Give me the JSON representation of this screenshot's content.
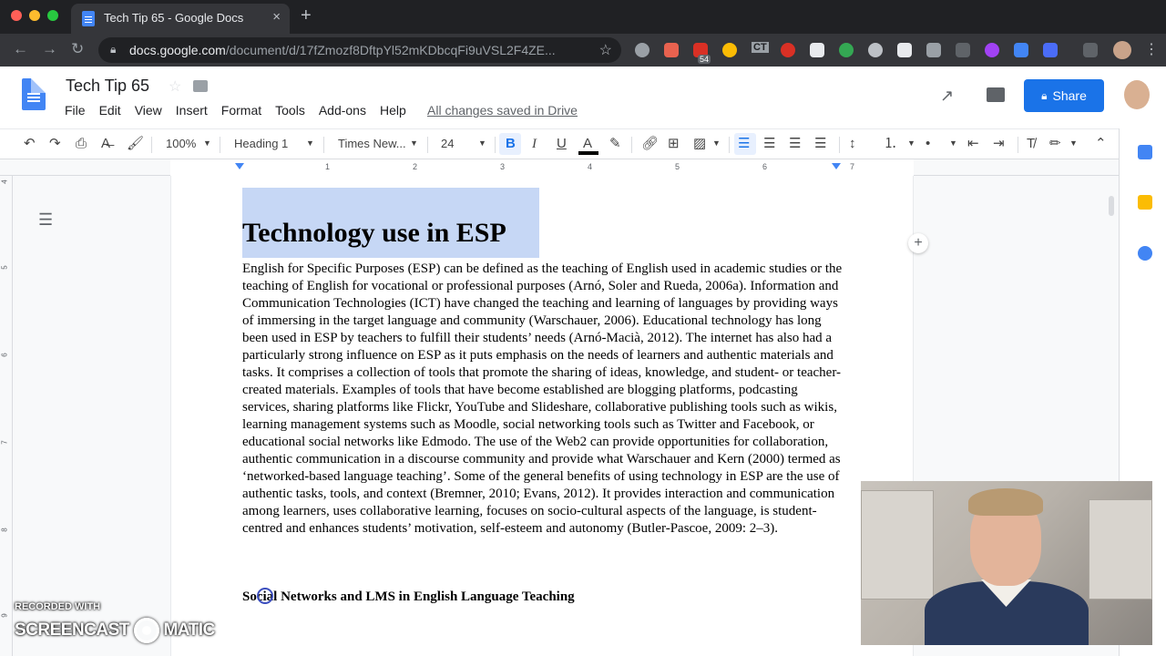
{
  "browser": {
    "tab_title": "Tech Tip 65 - Google Docs",
    "tab_close": "×",
    "new_tab": "+",
    "url_host": "docs.google.com",
    "url_path": "/document/d/17fZmozf8DftpYl52mKDbcqFi9uVSL2F4ZE...",
    "extension_badge": "54",
    "ext_ct_label": "CT"
  },
  "docs": {
    "title": "Tech Tip 65",
    "menu": [
      "File",
      "Edit",
      "View",
      "Insert",
      "Format",
      "Tools",
      "Add-ons",
      "Help"
    ],
    "saved_status": "All changes saved in Drive",
    "share_label": "Share"
  },
  "toolbar": {
    "zoom": "100%",
    "style": "Heading 1",
    "font": "Times New...",
    "size": "24",
    "bold": "B",
    "italic": "I",
    "underline": "U",
    "text_color": "A"
  },
  "ruler": {
    "numbers": [
      "1",
      "2",
      "3",
      "4",
      "5",
      "6",
      "7"
    ],
    "vertical_numbers": [
      "4",
      "5",
      "6",
      "7",
      "8",
      "9"
    ]
  },
  "document": {
    "heading": "Technology use in ESP",
    "body": "English for Specific Purposes (ESP) can be defined as the teaching of English used in academic studies or the teaching of English for vocational or professional purposes (Arnó, Soler and Rueda, 2006a). Information and Communication Technologies (ICT) have changed the teaching and learning of languages by providing ways of immersing in the target language and community (Warschauer, 2006). Educational technology has long been used in ESP by teachers to fulfill their students’ needs (Arnó-Macià, 2012). The internet has also had a particularly strong influence on ESP as it puts emphasis on the needs of learners and authentic materials and tasks. It comprises a collection of tools that promote the sharing of ideas, knowledge, and student- or teacher-created materials. Examples of tools that have become established are blogging platforms, podcasting services, sharing platforms like Flickr, YouTube and Slideshare, collaborative publishing tools such as wikis, learning management systems such as Moodle, social networking tools such as Twitter and Facebook, or educational social networks like Edmodo. The use of the Web2 can provide opportunities for collaboration, authentic communication in a discourse community and provide what Warschauer and Kern (2000) termed as ‘networked-based language teaching’. Some of the general benefits of using technology in ESP are the use of authentic tasks, tools, and context (Bremner, 2010; Evans, 2012). It provides interaction and communication among learners, uses collaborative learning, focuses on socio-cultural aspects of the language, is student-centred and enhances students’ motivation, self-esteem and autonomy (Butler-Pascoe, 2009: 2–3).",
    "subheading": "Social Networks and LMS in English Language Teaching"
  },
  "watermark": {
    "line1": "RECORDED WITH",
    "line2a": "SCREENCAST",
    "line2b": "MATIC"
  },
  "colors": {
    "accent": "#1a73e8",
    "selection": "#c6d7f5",
    "chrome_dark": "#202124"
  }
}
